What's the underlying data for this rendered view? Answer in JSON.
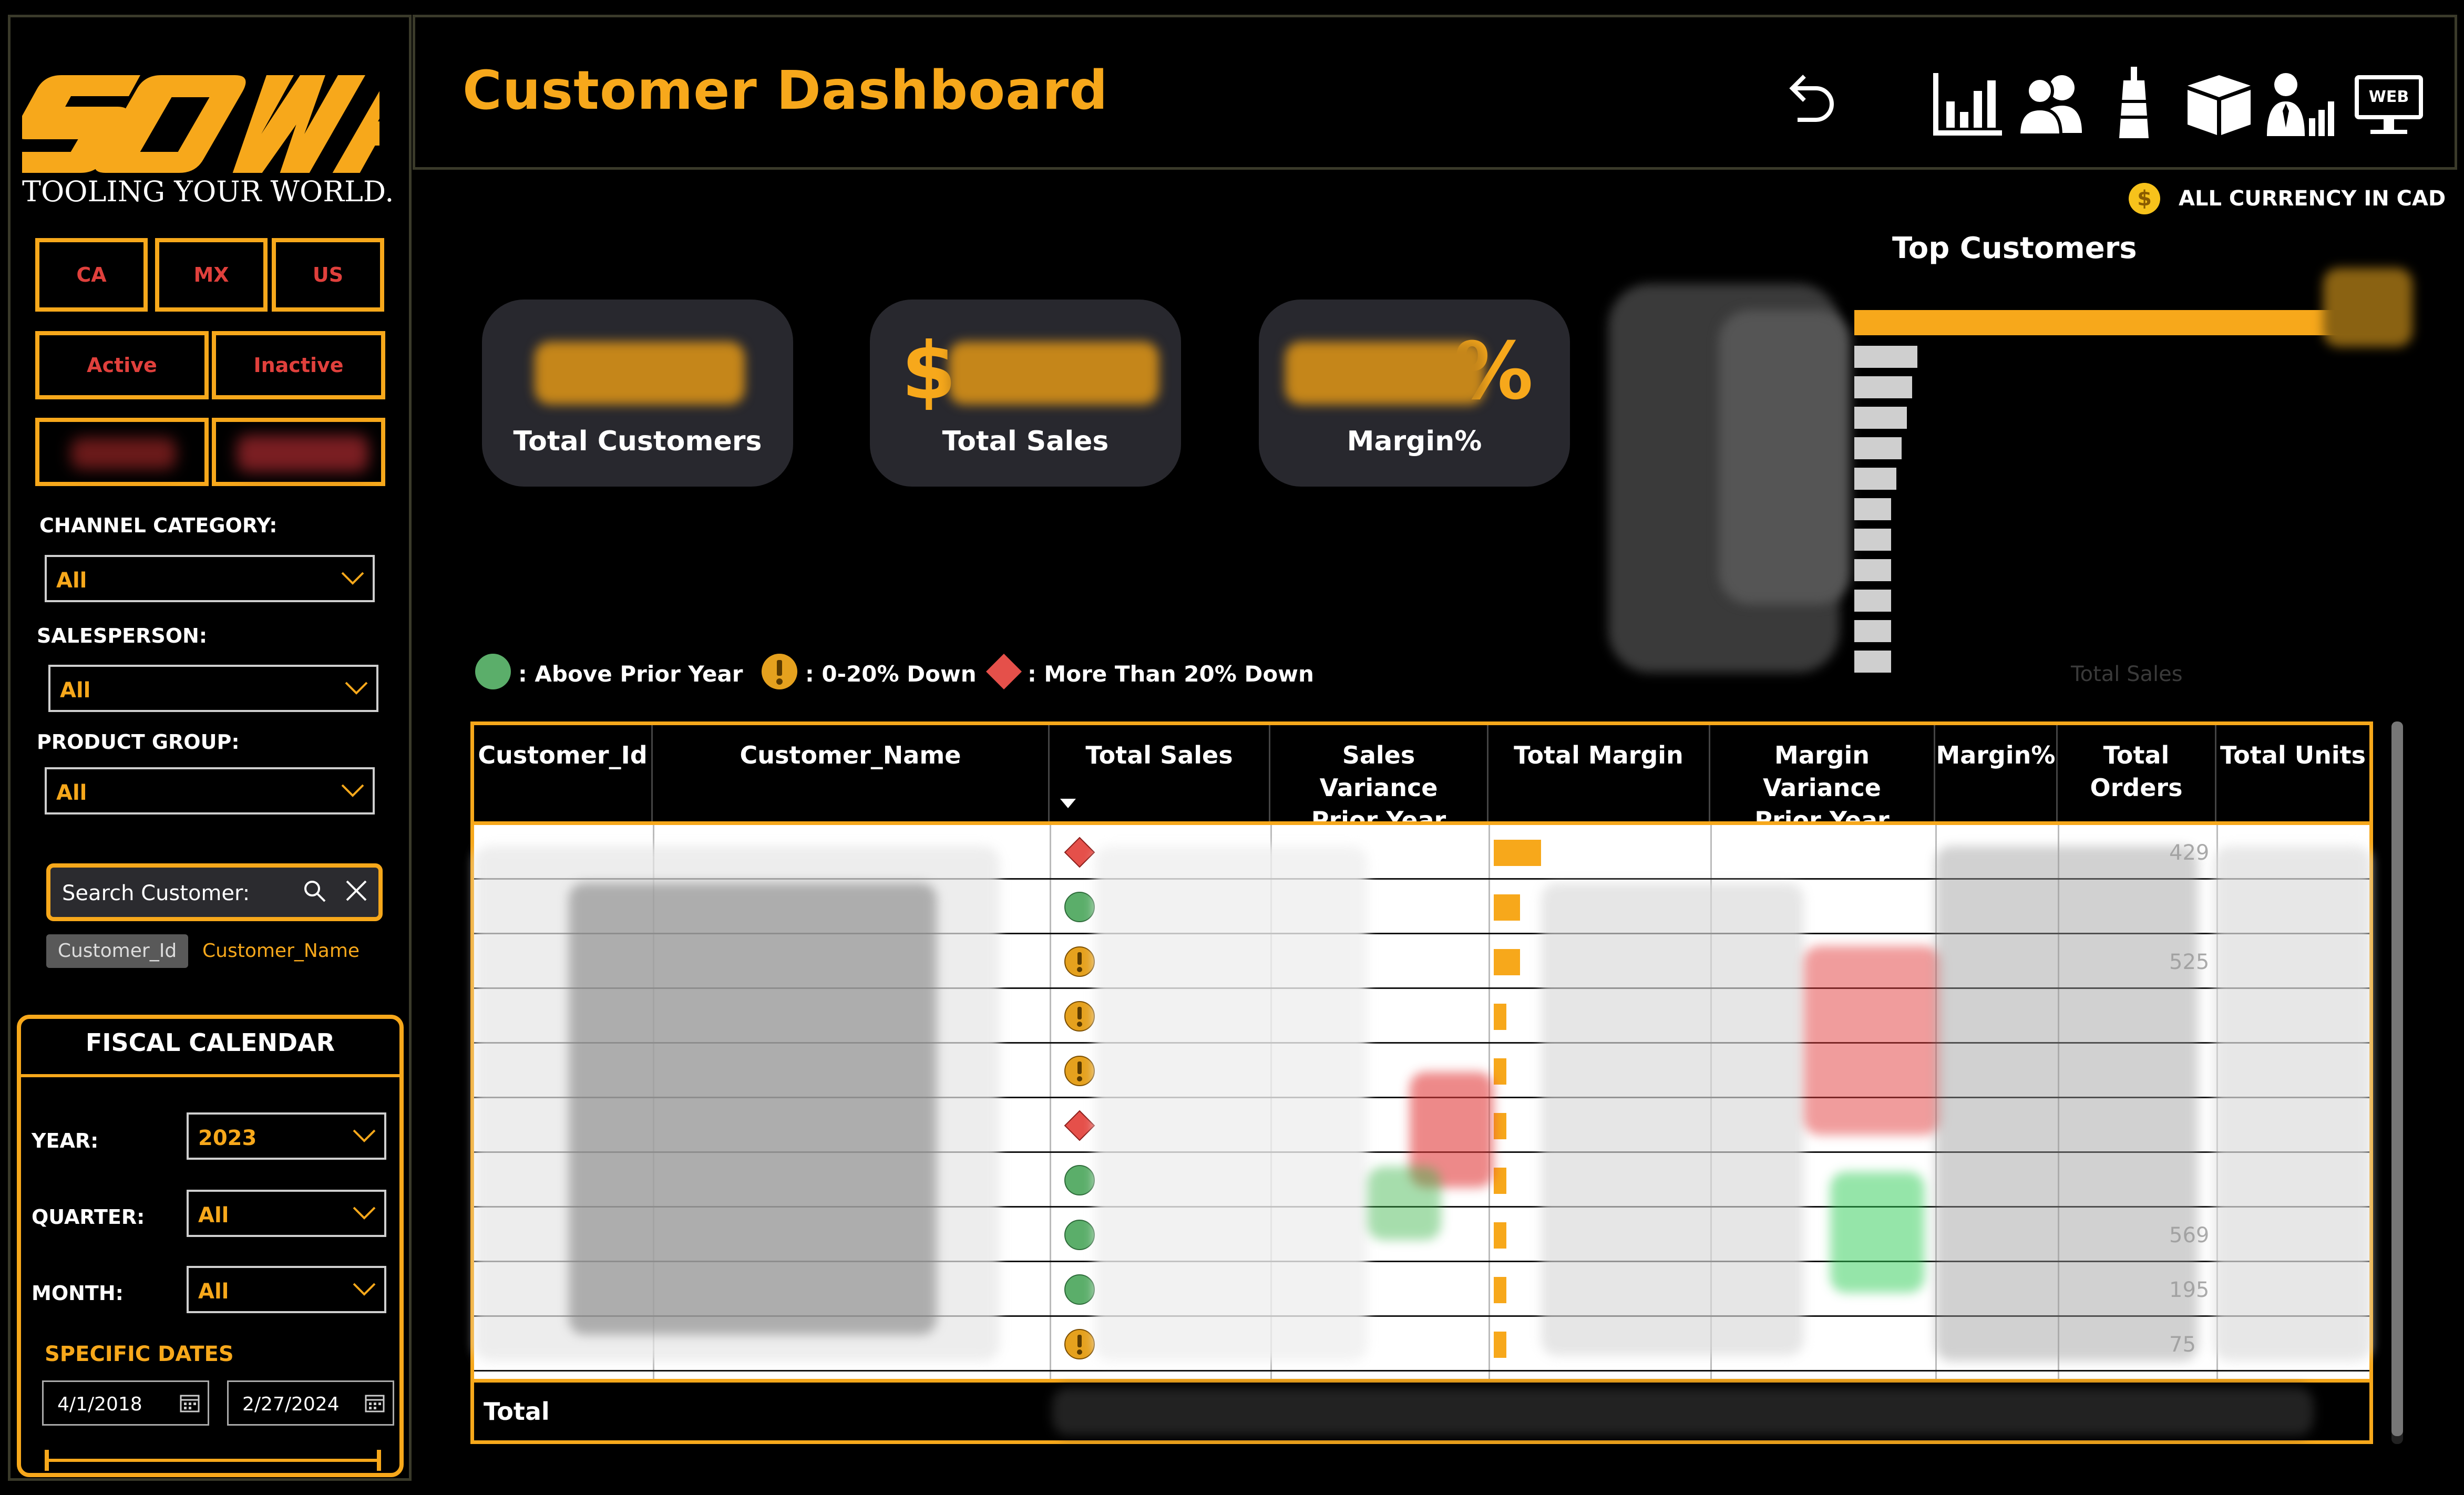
{
  "brand": {
    "logo_text": "SOWA",
    "tagline": "TOOLING YOUR WORLD."
  },
  "header": {
    "title": "Customer Dashboard",
    "currency_note": "ALL CURRENCY IN CAD",
    "nav_icons": [
      "back-icon",
      "bar-chart-icon",
      "customers-icon",
      "tool-icon",
      "box-icon",
      "salesperson-icon",
      "web-icon"
    ],
    "web_label": "WEB"
  },
  "filters": {
    "country_buttons": [
      "CA",
      "MX",
      "US"
    ],
    "status_buttons": [
      "Active",
      "Inactive"
    ],
    "channel_category": {
      "label": "CHANNEL CATEGORY:",
      "value": "All"
    },
    "salesperson": {
      "label": "SALESPERSON:",
      "value": "All"
    },
    "product_group": {
      "label": "PRODUCT GROUP:",
      "value": "All"
    },
    "search": {
      "placeholder": "Search Customer:",
      "toggle_options": [
        "Customer_Id",
        "Customer_Name"
      ]
    }
  },
  "fiscal_calendar": {
    "title": "FISCAL CALENDAR",
    "year": {
      "label": "YEAR:",
      "value": "2023"
    },
    "quarter": {
      "label": "QUARTER:",
      "value": "All"
    },
    "month": {
      "label": "MONTH:",
      "value": "All"
    },
    "specific_dates_label": "SPECIFIC DATES",
    "start_date": "4/1/2018",
    "end_date": "2/27/2024"
  },
  "kpis": [
    {
      "caption": "Total Customers"
    },
    {
      "caption": "Total Sales",
      "prefix": "$"
    },
    {
      "caption": "Margin%",
      "suffix": "%"
    }
  ],
  "top_customers": {
    "title": "Top Customers",
    "axis_label": "Total Sales",
    "bar_lengths_relative": [
      1.0,
      0.12,
      0.11,
      0.1,
      0.09,
      0.08,
      0.07,
      0.07,
      0.07,
      0.07,
      0.07,
      0.07
    ]
  },
  "legend": [
    {
      "shape": "circle",
      "color": "#5BAE6A",
      "label": ": Above Prior Year"
    },
    {
      "shape": "exclaim",
      "color": "#E5A11E",
      "label": ": 0-20% Down"
    },
    {
      "shape": "diamond",
      "color": "#E5504A",
      "label": ": More Than 20% Down"
    }
  ],
  "table": {
    "columns": [
      "Customer_Id",
      "Customer_Name",
      "Total Sales",
      "Sales Variance Prior Year",
      "Total Margin",
      "Margin Variance Prior Year",
      "Margin%",
      "Total Orders",
      "Total Units"
    ],
    "row_status": [
      "diamond",
      "circle",
      "exclaim",
      "exclaim",
      "exclaim",
      "diamond",
      "circle",
      "circle",
      "circle",
      "exclaim"
    ],
    "visible_fragments": {
      "orders_r1": "429",
      "orders_r3": "525",
      "orders_r8": "569",
      "orders_r9": "195",
      "orders_r10": "75"
    },
    "total_label": "Total"
  }
}
